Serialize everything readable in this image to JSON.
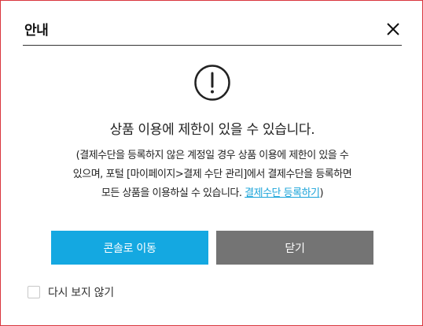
{
  "dialog": {
    "title": "안내",
    "close_icon": "close-icon",
    "warning_icon": "exclamation-circle-icon",
    "headline": "상품 이용에 제한이 있을 수 있습니다.",
    "description_line1": "(결제수단을 등록하지 않은 계정일 경우 상품 이용에 제한이 있을 수",
    "description_line2": "있으며, 포털 [마이페이지>결제 수단 관리]에서 결제수단을 등록하면",
    "description_line3": "모든 상품을 이용하실 수 있습니다.",
    "description_link": "결제수단 등록하기",
    "description_end": ")",
    "primary_button": "콘솔로 이동",
    "secondary_button": "닫기",
    "dont_show_label": "다시 보지 않기",
    "dont_show_checked": false
  },
  "colors": {
    "dialog_border": "#d9363e",
    "primary": "#14a8e1",
    "secondary": "#747474",
    "link": "#1aa3d9"
  }
}
